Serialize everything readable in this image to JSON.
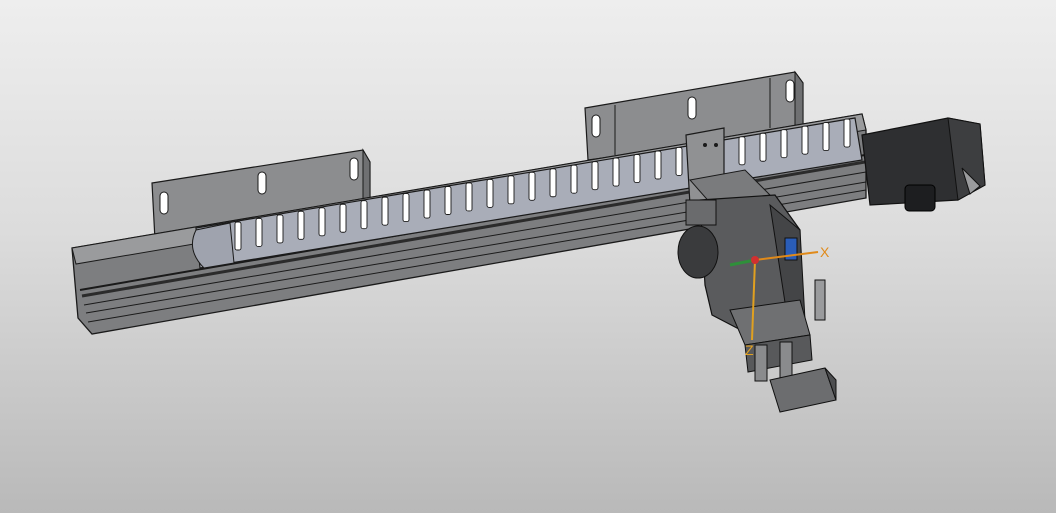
{
  "viewport": {
    "background_top": "#eeeeee",
    "background_bottom": "#b9b9b9"
  },
  "model": {
    "body_color": "#7d7e80",
    "body_dark": "#4a4b4d",
    "edge_color": "#1a1a1a",
    "bracket_color": "#8c8d8f",
    "chain_color": "#a9adb8",
    "motor_color": "#2e2f31"
  },
  "triad": {
    "x_label": "X",
    "y_label": "",
    "z_label": "Z",
    "x_color": "#e08a1a",
    "z_color": "#e0a020",
    "y_color": "#2f8f3a"
  }
}
